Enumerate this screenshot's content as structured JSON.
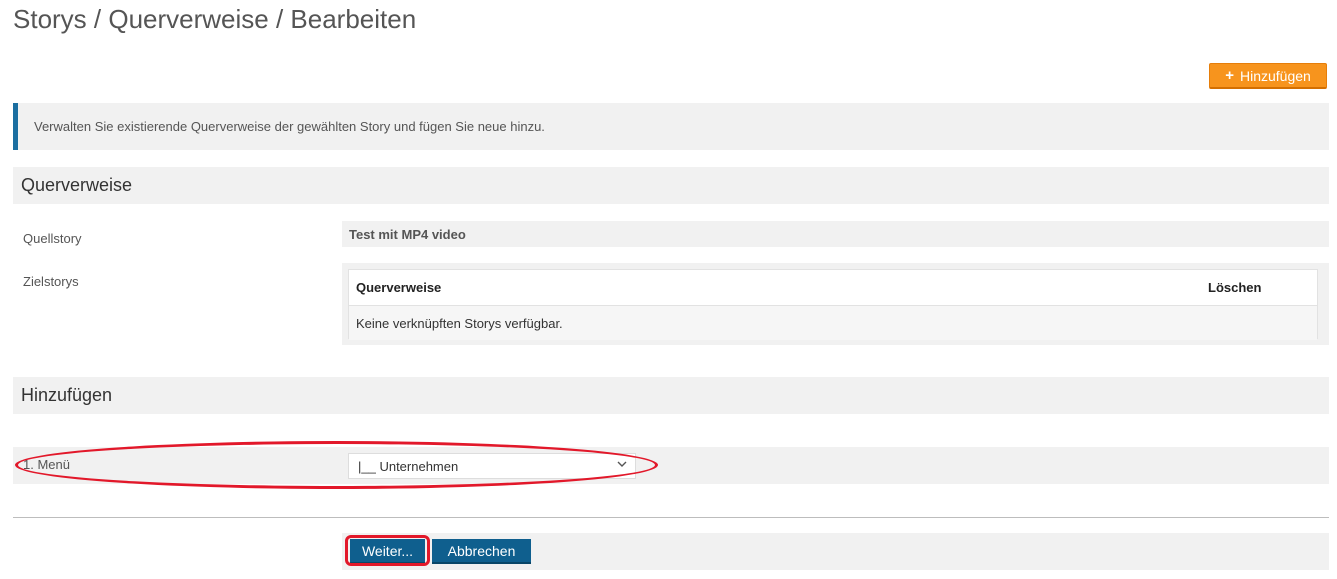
{
  "page": {
    "title": "Storys / Querverweise / Bearbeiten"
  },
  "toolbar": {
    "add_label": "Hinzufügen",
    "add_icon": "plus-icon",
    "add_color": "#f7941d"
  },
  "info": {
    "text": "Verwalten Sie existierende Querverweise der gewählten Story und fügen Sie neue hinzu."
  },
  "cross_refs_section": {
    "title": "Querverweise",
    "source_label": "Quellstory",
    "source_value": "Test mit MP4 video",
    "targets_label": "Zielstorys",
    "table": {
      "headers": [
        "Querverweise",
        "Löschen"
      ],
      "empty_text": "Keine verknüpften Storys verfügbar."
    }
  },
  "add_section": {
    "title": "Hinzufügen",
    "menu_label": "1. Menü",
    "menu_selected": "|__ Unternehmen",
    "dropdown_icon": "chevron-down-icon"
  },
  "footer": {
    "next_label": "Weiter...",
    "cancel_label": "Abbrechen",
    "button_color": "#0f5f8e",
    "highlight_color": "#e2182a"
  }
}
